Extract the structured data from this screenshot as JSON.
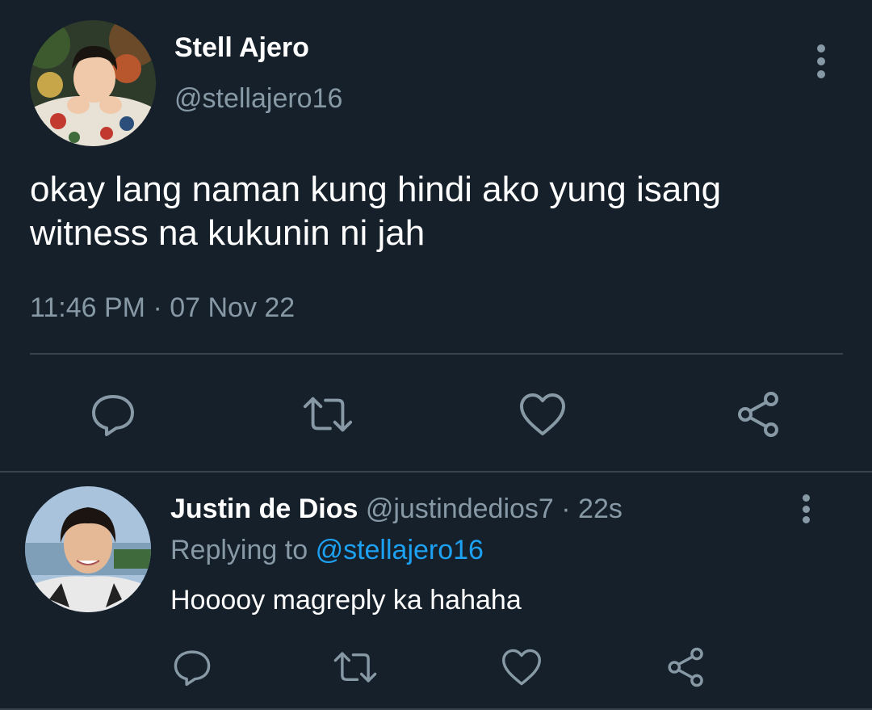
{
  "main_tweet": {
    "author_name": "Stell Ajero",
    "author_handle": "@stellajero16",
    "text": "okay lang naman kung hindi ako yung isang witness na kukunin ni jah",
    "timestamp": "11:46 PM · 07 Nov 22",
    "actions": [
      "reply-icon",
      "retweet-icon",
      "like-icon",
      "share-icon"
    ]
  },
  "reply": {
    "author_name": "Justin de Dios",
    "meta": "@justindedios7 · 22s",
    "replying_prefix": "Replying to",
    "replying_handle": "@stellajero16",
    "text": "Hooooy magreply ka hahaha",
    "actions": [
      "reply-icon",
      "retweet-icon",
      "like-icon",
      "share-icon"
    ]
  },
  "colors": {
    "background": "#15202b",
    "secondary_text": "#8899a6",
    "link": "#1da1f2",
    "divider": "#38444d"
  }
}
